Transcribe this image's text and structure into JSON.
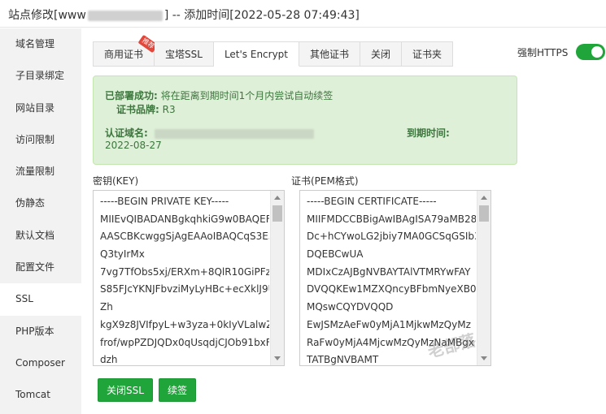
{
  "window": {
    "title_prefix": "站点修改[www",
    "title_suffix": "] -- 添加时间[2022-05-28 07:49:43]"
  },
  "sidebar": {
    "items": [
      {
        "label": "域名管理"
      },
      {
        "label": "子目录绑定"
      },
      {
        "label": "网站目录"
      },
      {
        "label": "访问限制"
      },
      {
        "label": "流量限制"
      },
      {
        "label": "伪静态"
      },
      {
        "label": "默认文档"
      },
      {
        "label": "配置文件"
      },
      {
        "label": "SSL"
      },
      {
        "label": "PHP版本"
      },
      {
        "label": "Composer"
      },
      {
        "label": "Tomcat"
      }
    ],
    "active": "SSL"
  },
  "tabs": [
    {
      "label": "商用证书",
      "badge": "推荐"
    },
    {
      "label": "宝塔SSL"
    },
    {
      "label": "Let's Encrypt"
    },
    {
      "label": "其他证书"
    },
    {
      "label": "关闭"
    },
    {
      "label": "证书夹"
    }
  ],
  "active_tab": "Let's Encrypt",
  "force_https": {
    "label": "强制HTTPS",
    "on": true
  },
  "status": {
    "deployed_label": "已部署成功:",
    "deployed_text": "将在距离到期时间1个月内尝试自动续签",
    "brand_label": "证书品牌:",
    "brand_value": "R3",
    "domain_label": "认证域名:",
    "expiry_label": "到期时间:",
    "expiry_value": "2022-08-27"
  },
  "key_box": {
    "label": "密钥(KEY)",
    "lines": [
      "-----BEGIN PRIVATE KEY-----",
      "MIIEvQIBADANBgkqhkiG9w0BAQEF",
      "AASCBKcwggSjAgEAAoIBAQCqS3E3",
      "Q3tyIrMx",
      "7vg7TfObs5xj/ERXm+8QlR10GiPFzJk",
      "S85FJcYKNJFbvziMyLyHBc+ecXklJ9U",
      "Zh",
      "kgX9z8JVIfpyL+w3yza+0kIyVLalwZH",
      "frof/wpPZDJQDx0qUsqdjCJOb91bxF",
      "dzh"
    ]
  },
  "cert_box": {
    "label": "证书(PEM格式)",
    "lines": [
      "-----BEGIN CERTIFICATE-----",
      "MIIFMDCCBBigAwIBAgISA79aMB28",
      "Dc+hCYwoLG2jbiy7MA0GCSqGSIb3",
      "DQEBCwUA",
      "MDIxCzAJBgNVBAYTAlVTMRYwFAY",
      "DVQQKEw1MZXQncyBFbmNyeXB0",
      "MQswCQYDVQQD",
      "EwJSMzAeFw0yMjA1MjkwMzQyMz",
      "RaFw0yMjA4MjcwMzQyMzNaMBgx",
      "TATBgNVBAMT"
    ]
  },
  "buttons": {
    "close_ssl": "关闭SSL",
    "renew": "续签"
  },
  "watermark": "老部落"
}
